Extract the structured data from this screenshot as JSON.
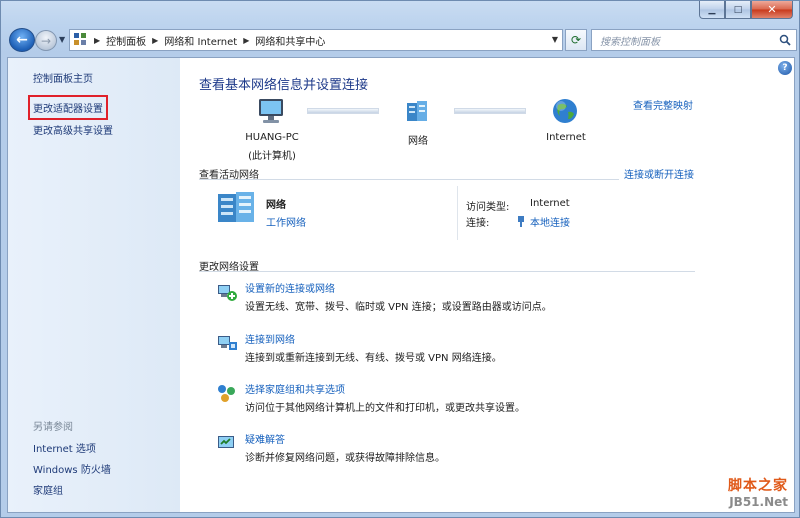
{
  "window": {
    "min_icon": "minimize-icon",
    "max_icon": "maximize-icon",
    "close_icon": "close-icon"
  },
  "nav": {
    "breadcrumbs": [
      "控制面板",
      "网络和 Internet",
      "网络和共享中心"
    ],
    "search_placeholder": "搜索控制面板"
  },
  "sidebar": {
    "home": "控制面板主页",
    "adapter": "更改适配器设置",
    "advanced": "更改高级共享设置",
    "see_also": "另请参阅",
    "see_also_items": [
      "Internet 选项",
      "Windows 防火墙",
      "家庭组"
    ]
  },
  "main": {
    "title": "查看基本网络信息并设置连接",
    "full_map": "查看完整映射",
    "nodes": {
      "pc": {
        "name": "HUANG-PC",
        "sub": "(此计算机)"
      },
      "network": {
        "name": "网络"
      },
      "internet": {
        "name": "Internet"
      }
    },
    "active_header": "查看活动网络",
    "connect_disconnect": "连接或断开连接",
    "active": {
      "name": "网络",
      "type": "工作网络",
      "access_label": "访问类型:",
      "access_value": "Internet",
      "conn_label": "连接:",
      "conn_value": "本地连接"
    },
    "change_header": "更改网络设置",
    "tasks": [
      {
        "title": "设置新的连接或网络",
        "desc": "设置无线、宽带、拨号、临时或 VPN 连接；或设置路由器或访问点。"
      },
      {
        "title": "连接到网络",
        "desc": "连接到或重新连接到无线、有线、拨号或 VPN 网络连接。"
      },
      {
        "title": "选择家庭组和共享选项",
        "desc": "访问位于其他网络计算机上的文件和打印机，或更改共享设置。"
      },
      {
        "title": "疑难解答",
        "desc": "诊断并修复网络问题，或获得故障排除信息。"
      }
    ]
  },
  "watermark": {
    "top": "脚本之家",
    "bottom": "JB51.Net"
  }
}
